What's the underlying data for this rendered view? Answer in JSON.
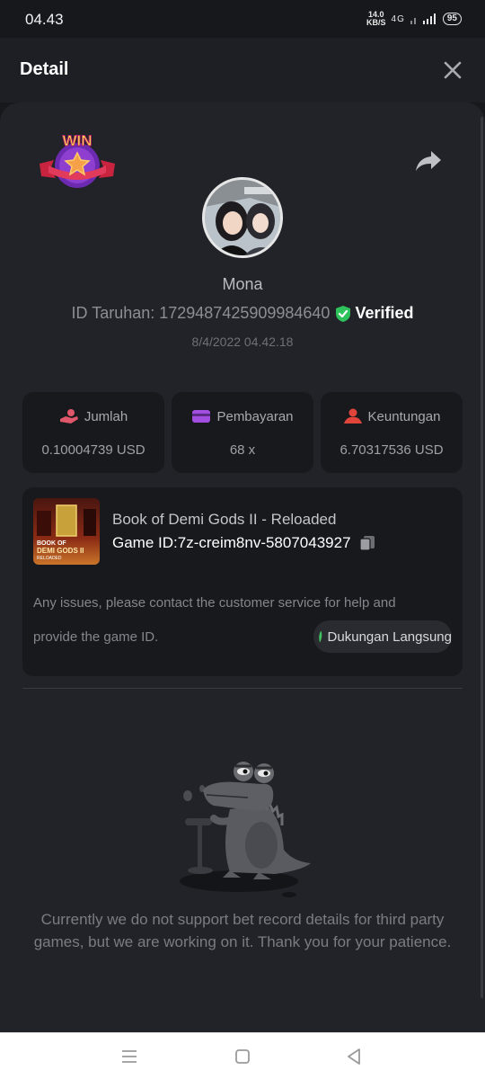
{
  "status_bar": {
    "time": "04.43",
    "net_speed_value": "14.0",
    "net_speed_unit": "KB/S",
    "signal_text": "4G",
    "battery": "95"
  },
  "header": {
    "title": "Detail"
  },
  "bet": {
    "badge_text": "WIN",
    "username": "Mona",
    "id_label": "ID Taruhan: 1729487425909984640",
    "verified_label": "Verified",
    "date": "8/4/2022 04.42.18"
  },
  "stats": [
    {
      "label": "Jumlah",
      "value": "0.10004739 USD",
      "icon": "money-hand-icon",
      "color": "#e0566a"
    },
    {
      "label": "Pembayaran",
      "value": "68 x",
      "icon": "wallet-card-icon",
      "color": "#a24ee0"
    },
    {
      "label": "Keuntungan",
      "value": "6.70317536 USD",
      "icon": "profit-user-icon",
      "color": "#e0453c"
    }
  ],
  "game": {
    "name": "Book of Demi Gods II - Reloaded",
    "game_id": "Game ID:7z-creim8nv-5807043927",
    "thumb_text_line1": "BOOK OF",
    "thumb_text_line2": "DEMI GODS II",
    "thumb_text_line3": "RELOADED",
    "notice_line1": "Any issues, please contact the customer service for help and",
    "notice_line2": "provide the game ID.",
    "support_label": "Dukungan Langsung"
  },
  "empty_state": {
    "message": "Currently we do not support bet record details for third party games, but we are working on it. Thank you for your patience."
  },
  "colors": {
    "background": "#17181c",
    "panel": "#222328",
    "card": "#18191d",
    "verified_green": "#2ec25b",
    "support_green": "#3fbf5f"
  }
}
